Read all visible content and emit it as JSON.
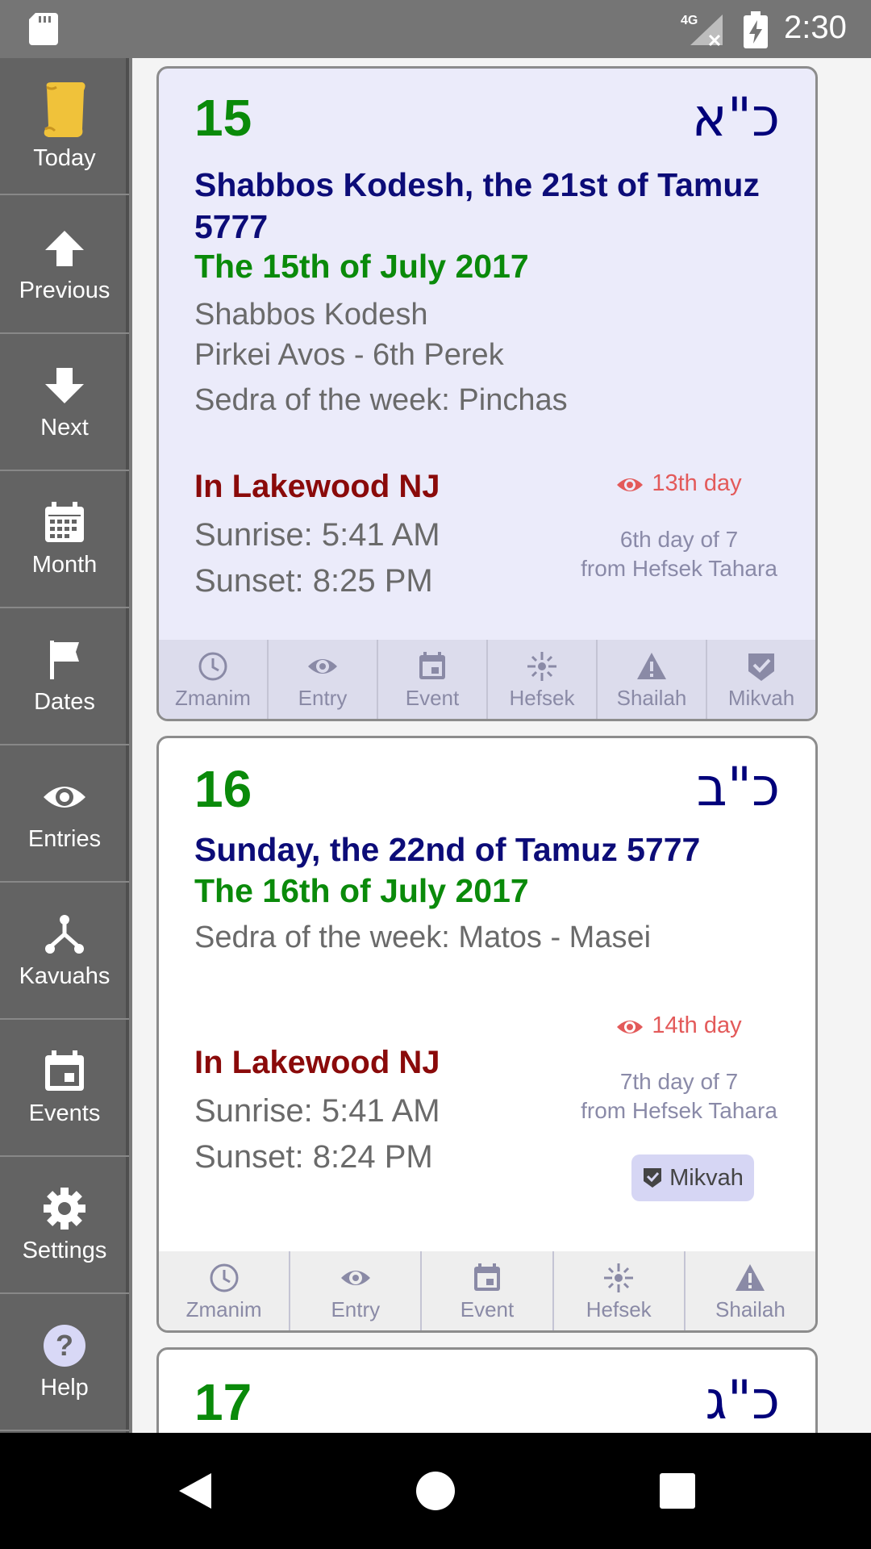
{
  "status_bar": {
    "network": "4G",
    "time": "2:30"
  },
  "sidebar": {
    "items": [
      {
        "label": "Today",
        "icon": "scroll-icon"
      },
      {
        "label": "Previous",
        "icon": "arrow-up-icon"
      },
      {
        "label": "Next",
        "icon": "arrow-down-icon"
      },
      {
        "label": "Month",
        "icon": "calendar-icon"
      },
      {
        "label": "Dates",
        "icon": "flag-icon"
      },
      {
        "label": "Entries",
        "icon": "eye-icon"
      },
      {
        "label": "Kavuahs",
        "icon": "fork-icon"
      },
      {
        "label": "Events",
        "icon": "event-icon"
      },
      {
        "label": "Settings",
        "icon": "gear-icon"
      },
      {
        "label": "Help",
        "icon": "help-icon"
      }
    ]
  },
  "cards": [
    {
      "day_num": "15",
      "heb_num": "כ\"א",
      "jewish_date": "Shabbos Kodesh, the 21st of Tamuz 5777",
      "secular_date": "The 15th of July 2017",
      "info_lines": [
        "Shabbos Kodesh",
        "Pirkei Avos - 6th Perek",
        "Sedra of the week: Pinchas"
      ],
      "location_title": "In Lakewood NJ",
      "sunrise": "Sunrise: 5:41 AM",
      "sunset": "Sunset: 8:25 PM",
      "entry_day": "13th day",
      "hefsek_line1": "6th day of 7",
      "hefsek_line2": "from Hefsek Tahara",
      "footer": [
        "Zmanim",
        "Entry",
        "Event",
        "Hefsek",
        "Shailah",
        "Mikvah"
      ]
    },
    {
      "day_num": "16",
      "heb_num": "כ\"ב",
      "jewish_date": "Sunday, the 22nd of Tamuz 5777",
      "secular_date": "The 16th of July 2017",
      "info_lines": [
        "Sedra of the week: Matos - Masei"
      ],
      "location_title": "In Lakewood NJ",
      "sunrise": "Sunrise: 5:41 AM",
      "sunset": "Sunset: 8:24 PM",
      "entry_day": "14th day",
      "hefsek_line1": "7th day of 7",
      "hefsek_line2": "from Hefsek Tahara",
      "mikvah_badge": "Mikvah",
      "footer": [
        "Zmanim",
        "Entry",
        "Event",
        "Hefsek",
        "Shailah"
      ]
    },
    {
      "day_num": "17",
      "heb_num": "כ\"ג"
    }
  ],
  "colors": {
    "green": "#0a8a0a",
    "navy": "#0c0c78",
    "maroon": "#8a0a0a",
    "entry_red": "#e35a5a",
    "today_bg": "#ebebfa"
  }
}
